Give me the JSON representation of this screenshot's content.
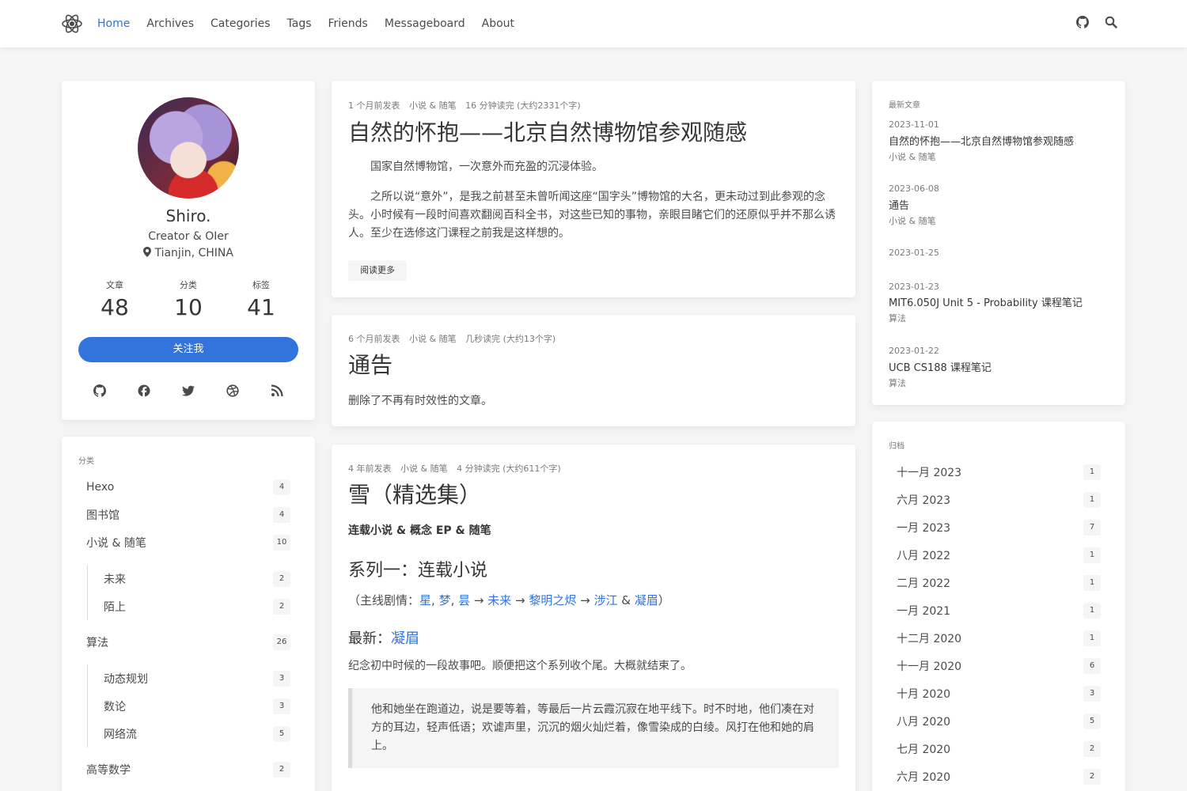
{
  "nav": {
    "links": [
      "Home",
      "Archives",
      "Categories",
      "Tags",
      "Friends",
      "Messageboard",
      "About"
    ],
    "active": "Home"
  },
  "profile": {
    "name": "Shiro.",
    "tagline": "Creator & OIer",
    "location": "Tianjin, CHINA",
    "stats": [
      {
        "label": "文章",
        "value": "48"
      },
      {
        "label": "分类",
        "value": "10"
      },
      {
        "label": "标签",
        "value": "41"
      }
    ],
    "follow_label": "关注我",
    "socials": [
      "github-icon",
      "facebook-icon",
      "twitter-icon",
      "dribbble-icon",
      "rss-icon"
    ]
  },
  "categories": {
    "label": "分类",
    "items": [
      {
        "name": "Hexo",
        "count": "4"
      },
      {
        "name": "图书馆",
        "count": "4"
      },
      {
        "name": "小说 & 随笔",
        "count": "10"
      },
      {
        "name": "未来",
        "count": "2"
      },
      {
        "name": "陌上",
        "count": "2"
      },
      {
        "name": "算法",
        "count": "26"
      },
      {
        "name": "动态规划",
        "count": "3"
      },
      {
        "name": "数论",
        "count": "3"
      },
      {
        "name": "网络流",
        "count": "5"
      },
      {
        "name": "高等数学",
        "count": "2"
      }
    ]
  },
  "posts": [
    {
      "time": "1 个月前发表",
      "category": "小说 & 随笔",
      "read": "16 分钟读完 (大约2331个字)",
      "title": "自然的怀抱——北京自然博物馆参观随感",
      "p1": "国家自然博物馆，一次意外而充盈的沉浸体验。",
      "p2": "之所以说“意外”，是我之前甚至未曾听闻这座“国字头”博物馆的大名，更未动过到此参观的念头。小时候有一段时间喜欢翻阅百科全书，对这些已知的事物，亲眼目睹它们的还原似乎并不那么诱人。至少在选修这门课程之前我是这样想的。",
      "read_more": "阅读更多"
    },
    {
      "time": "6 个月前发表",
      "category": "小说 & 随笔",
      "read": "几秒读完 (大约13个字)",
      "title": "通告",
      "p1": "删除了不再有时效性的文章。"
    },
    {
      "time": "4 年前发表",
      "category": "小说 & 随笔",
      "read": "4 分钟读完 (大约611个字)",
      "title": "雪（精选集）",
      "bold": "连载小说 & 概念 EP & 随笔",
      "h2": "系列一：连载小说",
      "plot_prefix": "（主线剧情：",
      "plot_links": [
        "星",
        "梦",
        "昙",
        "未来",
        "黎明之烬",
        "涉江",
        "凝眉"
      ],
      "plot_suffix": "）",
      "latest_prefix": "最新：",
      "latest_link": "凝眉",
      "p1": "纪念初中时候的一段故事吧。顺便把这个系列收个尾。大概就结束了。",
      "quote": "他和她坐在跑道边，说是要等着，等最后一片云霞沉寂在地平线下。时不时地，他们凑在对方的耳边，轻声低语；欢谑声里，沉沉的烟火灿烂着，像雪染成的白绫。风打在他和她的肩上。"
    }
  ],
  "recent": {
    "label": "最新文章",
    "items": [
      {
        "date": "2023-11-01",
        "title": "自然的怀抱——北京自然博物馆参观随感",
        "cat": "小说 & 随笔"
      },
      {
        "date": "2023-06-08",
        "title": "通告",
        "cat": "小说 & 随笔"
      },
      {
        "date": "2023-01-25",
        "title": "",
        "cat": ""
      },
      {
        "date": "2023-01-23",
        "title": "MIT6.050J Unit 5 - Probability 课程笔记",
        "cat": "算法"
      },
      {
        "date": "2023-01-22",
        "title": "UCB CS188 课程笔记",
        "cat": "算法"
      }
    ]
  },
  "archive": {
    "label": "归档",
    "items": [
      {
        "month": "十一月 2023",
        "count": "1"
      },
      {
        "month": "六月 2023",
        "count": "1"
      },
      {
        "month": "一月 2023",
        "count": "7"
      },
      {
        "month": "八月 2022",
        "count": "1"
      },
      {
        "month": "二月 2022",
        "count": "1"
      },
      {
        "month": "一月 2021",
        "count": "1"
      },
      {
        "month": "十二月 2020",
        "count": "1"
      },
      {
        "month": "十一月 2020",
        "count": "6"
      },
      {
        "month": "十月 2020",
        "count": "3"
      },
      {
        "month": "八月 2020",
        "count": "5"
      },
      {
        "month": "七月 2020",
        "count": "2"
      },
      {
        "month": "六月 2020",
        "count": "2"
      }
    ]
  }
}
